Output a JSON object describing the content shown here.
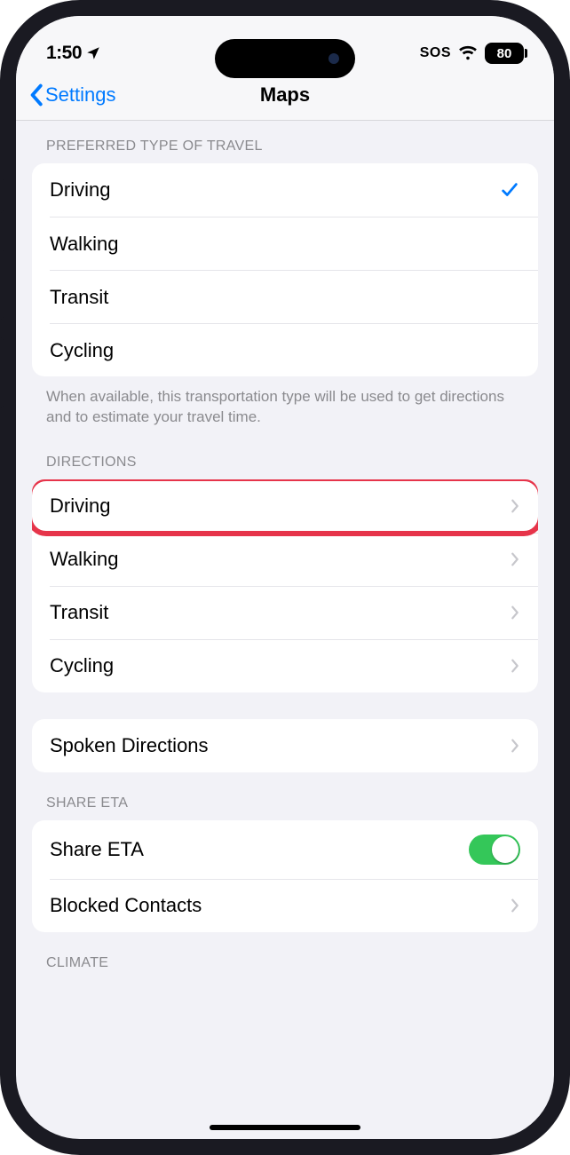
{
  "status": {
    "time": "1:50",
    "sos": "SOS",
    "battery": "80"
  },
  "nav": {
    "back": "Settings",
    "title": "Maps"
  },
  "travel": {
    "header": "Preferred Type of Travel",
    "items": [
      "Driving",
      "Walking",
      "Transit",
      "Cycling"
    ],
    "selected_index": 0,
    "footer": "When available, this transportation type will be used to get directions and to estimate your travel time."
  },
  "directions": {
    "header": "Directions",
    "items": [
      "Driving",
      "Walking",
      "Transit",
      "Cycling"
    ],
    "highlight_index": 0,
    "spoken": "Spoken Directions"
  },
  "share_eta": {
    "header": "Share ETA",
    "share_label": "Share ETA",
    "share_on": true,
    "blocked": "Blocked Contacts"
  },
  "climate": {
    "header": "Climate"
  }
}
